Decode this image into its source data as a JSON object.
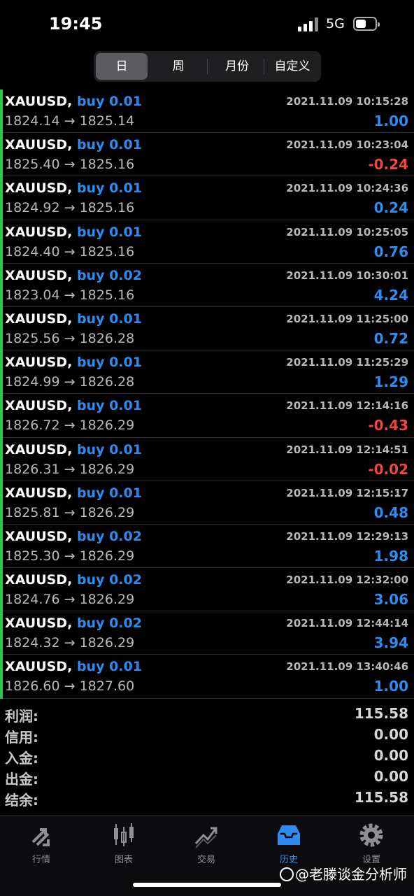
{
  "status": {
    "time": "19:45",
    "network": "5G"
  },
  "tabs": [
    {
      "label": "日",
      "active": true
    },
    {
      "label": "周",
      "active": false
    },
    {
      "label": "月份",
      "active": false
    },
    {
      "label": "自定义",
      "active": false
    }
  ],
  "deals": [
    {
      "symbol": "XAUUSD,",
      "side": "buy 0.01",
      "time": "2021.11.09 10:15:28",
      "open": "1824.14",
      "arrow": "→",
      "close": "1825.14",
      "profit": "1.00"
    },
    {
      "symbol": "XAUUSD,",
      "side": "buy 0.01",
      "time": "2021.11.09 10:23:04",
      "open": "1825.40",
      "arrow": "→",
      "close": "1825.16",
      "profit": "-0.24"
    },
    {
      "symbol": "XAUUSD,",
      "side": "buy 0.01",
      "time": "2021.11.09 10:24:36",
      "open": "1824.92",
      "arrow": "→",
      "close": "1825.16",
      "profit": "0.24"
    },
    {
      "symbol": "XAUUSD,",
      "side": "buy 0.01",
      "time": "2021.11.09 10:25:05",
      "open": "1824.40",
      "arrow": "→",
      "close": "1825.16",
      "profit": "0.76"
    },
    {
      "symbol": "XAUUSD,",
      "side": "buy 0.02",
      "time": "2021.11.09 10:30:01",
      "open": "1823.04",
      "arrow": "→",
      "close": "1825.16",
      "profit": "4.24"
    },
    {
      "symbol": "XAUUSD,",
      "side": "buy 0.01",
      "time": "2021.11.09 11:25:00",
      "open": "1825.56",
      "arrow": "→",
      "close": "1826.28",
      "profit": "0.72"
    },
    {
      "symbol": "XAUUSD,",
      "side": "buy 0.01",
      "time": "2021.11.09 11:25:29",
      "open": "1824.99",
      "arrow": "→",
      "close": "1826.28",
      "profit": "1.29"
    },
    {
      "symbol": "XAUUSD,",
      "side": "buy 0.01",
      "time": "2021.11.09 12:14:16",
      "open": "1826.72",
      "arrow": "→",
      "close": "1826.29",
      "profit": "-0.43"
    },
    {
      "symbol": "XAUUSD,",
      "side": "buy 0.01",
      "time": "2021.11.09 12:14:51",
      "open": "1826.31",
      "arrow": "→",
      "close": "1826.29",
      "profit": "-0.02"
    },
    {
      "symbol": "XAUUSD,",
      "side": "buy 0.01",
      "time": "2021.11.09 12:15:17",
      "open": "1825.81",
      "arrow": "→",
      "close": "1826.29",
      "profit": "0.48"
    },
    {
      "symbol": "XAUUSD,",
      "side": "buy 0.02",
      "time": "2021.11.09 12:29:13",
      "open": "1825.30",
      "arrow": "→",
      "close": "1826.29",
      "profit": "1.98"
    },
    {
      "symbol": "XAUUSD,",
      "side": "buy 0.02",
      "time": "2021.11.09 12:32:00",
      "open": "1824.76",
      "arrow": "→",
      "close": "1826.29",
      "profit": "3.06"
    },
    {
      "symbol": "XAUUSD,",
      "side": "buy 0.02",
      "time": "2021.11.09 12:44:14",
      "open": "1824.32",
      "arrow": "→",
      "close": "1826.29",
      "profit": "3.94"
    },
    {
      "symbol": "XAUUSD,",
      "side": "buy 0.01",
      "time": "2021.11.09 13:40:46",
      "open": "1826.60",
      "arrow": "→",
      "close": "1827.60",
      "profit": "1.00"
    }
  ],
  "summary": [
    {
      "label": "利润:",
      "value": "115.58"
    },
    {
      "label": "信用:",
      "value": "0.00"
    },
    {
      "label": "入金:",
      "value": "0.00"
    },
    {
      "label": "出金:",
      "value": "0.00"
    },
    {
      "label": "结余:",
      "value": "115.58"
    }
  ],
  "nav": [
    {
      "label": "行情",
      "icon": "quotes-arrows-icon",
      "active": false
    },
    {
      "label": "图表",
      "icon": "candlestick-chart-icon",
      "active": false
    },
    {
      "label": "交易",
      "icon": "trade-chart-icon",
      "active": false
    },
    {
      "label": "历史",
      "icon": "history-tray-icon",
      "active": true
    },
    {
      "label": "设置",
      "icon": "gear-icon",
      "active": false
    }
  ],
  "watermark": "@老滕谈金分析师",
  "colors": {
    "accent": "#2e8cf0",
    "loss": "#f2453d",
    "list_marker": "#2ec64a"
  }
}
